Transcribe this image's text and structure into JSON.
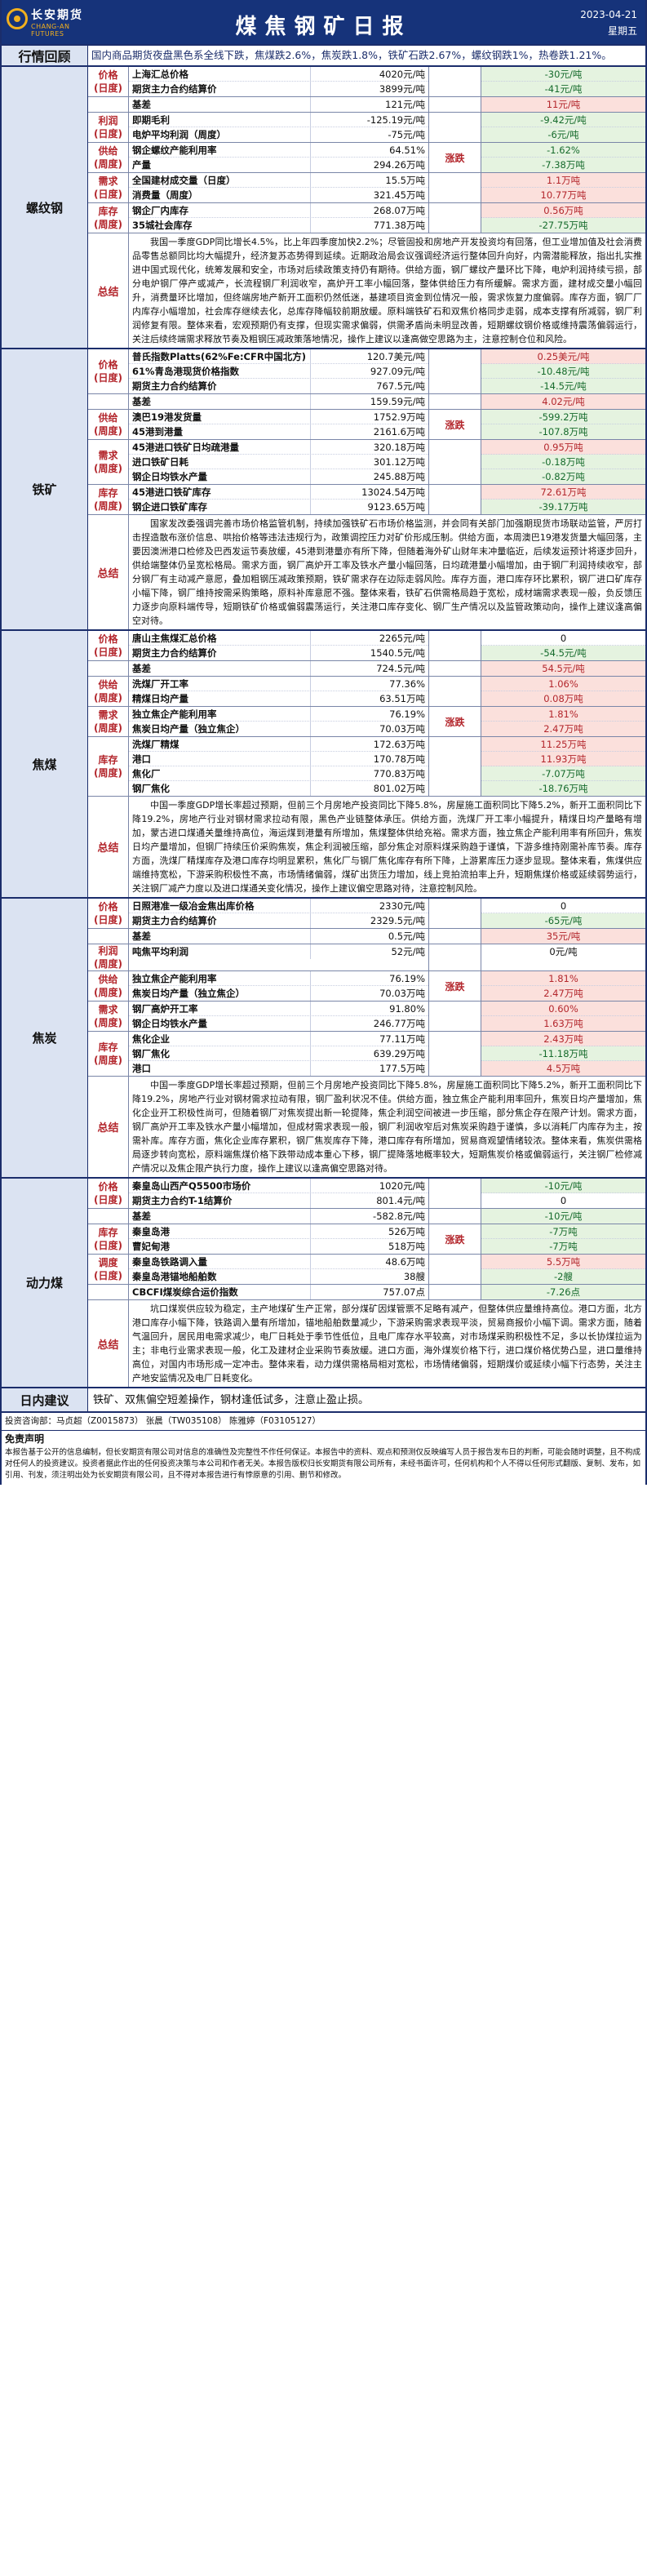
{
  "header": {
    "logo_cn": "长安期货",
    "logo_en": "CHANG-AN FUTURES",
    "title": "煤焦钢矿日报",
    "date": "2023-04-21",
    "weekday": "星期五"
  },
  "review": {
    "label": "行情回顾",
    "text": "国内商品期货夜盘黑色系全线下跌，焦煤跌2.6%，焦炭跌1.8%，铁矿石跌2.67%，螺纹钢跌1%，热卷跌1.21%。"
  },
  "colors": {
    "header_bg": "#16337a",
    "label_bg": "#dbe3f2",
    "negative": "#166b2c",
    "positive": "#b3262c"
  },
  "sections": [
    {
      "name": "螺纹钢",
      "groups": [
        {
          "label": [
            "价格",
            "(日度)"
          ],
          "trend": "",
          "rows": [
            {
              "name": "上海汇总价格",
              "value": "4020元/吨",
              "change": "-30元/吨",
              "sign": "neg"
            },
            {
              "name": "期货主力合约结算价",
              "value": "3899元/吨",
              "change": "-41元/吨",
              "sign": "neg"
            }
          ]
        },
        {
          "label": [
            ""
          ],
          "trend": "",
          "rows": [
            {
              "name": "基差",
              "value": "121元/吨",
              "change": "11元/吨",
              "sign": "pos"
            }
          ]
        },
        {
          "label": [
            "利润",
            "(日度)"
          ],
          "trend": "",
          "rows": [
            {
              "name": "即期毛利",
              "value": "-125.19元/吨",
              "change": "-9.42元/吨",
              "sign": "neg"
            },
            {
              "name": "电炉平均利润（周度）",
              "value": "-75元/吨",
              "change": "-6元/吨",
              "sign": "neg"
            }
          ]
        },
        {
          "label": [
            "供给",
            "(周度)"
          ],
          "trend": "涨跌",
          "rows": [
            {
              "name": "钢企螺纹产能利用率",
              "value": "64.51%",
              "change": "-1.62%",
              "sign": "neg"
            },
            {
              "name": "产量",
              "value": "294.26万吨",
              "change": "-7.38万吨",
              "sign": "neg"
            }
          ]
        },
        {
          "label": [
            "需求",
            "(日度)"
          ],
          "trend": "",
          "rows": [
            {
              "name": "全国建材成交量（日度）",
              "value": "15.5万吨",
              "change": "1.1万吨",
              "sign": "pos"
            },
            {
              "name": "消费量（周度）",
              "value": "321.45万吨",
              "change": "10.77万吨",
              "sign": "pos"
            }
          ]
        },
        {
          "label": [
            "库存",
            "(周度)"
          ],
          "trend": "",
          "rows": [
            {
              "name": "钢企厂内库存",
              "value": "268.07万吨",
              "change": "0.56万吨",
              "sign": "pos"
            },
            {
              "name": "35城社会库存",
              "value": "771.38万吨",
              "change": "-27.75万吨",
              "sign": "neg"
            }
          ]
        }
      ],
      "summary": "我国一季度GDP同比增长4.5%，比上年四季度加快2.2%；尽管固投和房地产开发投资均有回落，但工业增加值及社会消费品零售总额同比均大幅提升，经济复苏态势得到延续。近期政治局会议强调经济运行整体回升向好，内需潜能释放，指出扎实推进中国式现代化，统筹发展和安全，市场对后续政策支持仍有期待。供给方面，钢厂螺纹产量环比下降，电炉利润持续亏损，部分电炉钢厂停产或减产，长流程钢厂利润收窄，高炉开工率小幅回落，整体供给压力有所缓解。需求方面，建材成交量小幅回升，消费量环比增加，但终端房地产新开工面积仍然低迷，基建项目资金到位情况一般，需求恢复力度偏弱。库存方面，钢厂厂内库存小幅增加，社会库存继续去化，总库存降幅较前期放缓。原料端铁矿石和双焦价格同步走弱，成本支撑有所减弱，钢厂利润修复有限。整体来看，宏观预期仍有支撑，但现实需求偏弱，供需矛盾尚未明显改善，短期螺纹钢价格或维持震荡偏弱运行，关注后续终端需求释放节奏及粗钢压减政策落地情况，操作上建议以逢高做空思路为主，注意控制仓位和风险。"
    },
    {
      "name": "铁矿",
      "groups": [
        {
          "label": [
            "价格",
            "(日度)"
          ],
          "trend": "",
          "rows": [
            {
              "name": "普氏指数Platts(62%Fe:CFR中国北方)",
              "value": "120.7美元/吨",
              "change": "0.25美元/吨",
              "sign": "pos"
            },
            {
              "name": "61%青岛港现货价格指数",
              "value": "927.09元/吨",
              "change": "-10.48元/吨",
              "sign": "neg"
            },
            {
              "name": "期货主力合约结算价",
              "value": "767.5元/吨",
              "change": "-14.5元/吨",
              "sign": "neg"
            }
          ]
        },
        {
          "label": [
            ""
          ],
          "trend": "",
          "rows": [
            {
              "name": "基差",
              "value": "159.59元/吨",
              "change": "4.02元/吨",
              "sign": "pos"
            }
          ]
        },
        {
          "label": [
            "供给",
            "(周度)"
          ],
          "trend": "涨跌",
          "rows": [
            {
              "name": "澳巴19港发货量",
              "value": "1752.9万吨",
              "change": "-599.2万吨",
              "sign": "neg"
            },
            {
              "name": "45港到港量",
              "value": "2161.6万吨",
              "change": "-107.8万吨",
              "sign": "neg"
            }
          ]
        },
        {
          "label": [
            "需求",
            "(周度)"
          ],
          "trend": "",
          "rows": [
            {
              "name": "45港进口铁矿日均疏港量",
              "value": "320.18万吨",
              "change": "0.95万吨",
              "sign": "pos"
            },
            {
              "name": "进口铁矿日耗",
              "value": "301.12万吨",
              "change": "-0.18万吨",
              "sign": "neg"
            },
            {
              "name": "钢企日均铁水产量",
              "value": "245.88万吨",
              "change": "-0.82万吨",
              "sign": "neg"
            }
          ]
        },
        {
          "label": [
            "库存",
            "(周度)"
          ],
          "trend": "",
          "rows": [
            {
              "name": "45港进口铁矿库存",
              "value": "13024.54万吨",
              "change": "72.61万吨",
              "sign": "pos"
            },
            {
              "name": "钢企进口铁矿库存",
              "value": "9123.65万吨",
              "change": "-39.17万吨",
              "sign": "neg"
            }
          ]
        }
      ],
      "summary": "国家发改委强调完善市场价格监管机制，持续加强铁矿石市场价格监测，并会同有关部门加强期现货市场联动监管，严厉打击捏造散布涨价信息、哄抬价格等违法违规行为，政策调控压力对矿价形成压制。供给方面，本周澳巴19港发货量大幅回落，主要因澳洲港口检修及巴西发运节奏放缓，45港到港量亦有所下降，但随着海外矿山财年末冲量临近，后续发运预计将逐步回升，供给端整体仍呈宽松格局。需求方面，钢厂高炉开工率及铁水产量小幅回落，日均疏港量小幅增加，由于钢厂利润持续收窄，部分钢厂有主动减产意愿，叠加粗钢压减政策预期，铁矿需求存在边际走弱风险。库存方面，港口库存环比累积，钢厂进口矿库存小幅下降，钢厂维持按需采购策略，原料补库意愿不强。整体来看，铁矿石供需格局趋于宽松，成材端需求表现一般，负反馈压力逐步向原料端传导，短期铁矿价格或偏弱震荡运行，关注港口库存变化、钢厂生产情况以及监管政策动向，操作上建议逢高偏空对待。"
    },
    {
      "name": "焦煤",
      "groups": [
        {
          "label": [
            "价格",
            "(日度)"
          ],
          "trend": "",
          "rows": [
            {
              "name": "唐山主焦煤汇总价格",
              "value": "2265元/吨",
              "change": "0",
              "sign": "zero"
            },
            {
              "name": "期货主力合约结算价",
              "value": "1540.5元/吨",
              "change": "-54.5元/吨",
              "sign": "neg"
            }
          ]
        },
        {
          "label": [
            ""
          ],
          "trend": "",
          "rows": [
            {
              "name": "基差",
              "value": "724.5元/吨",
              "change": "54.5元/吨",
              "sign": "pos"
            }
          ]
        },
        {
          "label": [
            "供给",
            "(周度)"
          ],
          "trend": "",
          "rows": [
            {
              "name": "洗煤厂开工率",
              "value": "77.36%",
              "change": "1.06%",
              "sign": "pos"
            },
            {
              "name": "精煤日均产量",
              "value": "63.51万吨",
              "change": "0.08万吨",
              "sign": "pos"
            }
          ]
        },
        {
          "label": [
            "需求",
            "(周度)"
          ],
          "trend": "涨跌",
          "rows": [
            {
              "name": "独立焦企产能利用率",
              "value": "76.19%",
              "change": "1.81%",
              "sign": "pos"
            },
            {
              "name": "焦炭日均产量（独立焦企）",
              "value": "70.03万吨",
              "change": "2.47万吨",
              "sign": "pos"
            }
          ]
        },
        {
          "label": [
            "库存",
            "(周度)"
          ],
          "trend": "",
          "rows": [
            {
              "name": "洗煤厂精煤",
              "value": "172.63万吨",
              "change": "11.25万吨",
              "sign": "pos"
            },
            {
              "name": "港口",
              "value": "170.78万吨",
              "change": "11.93万吨",
              "sign": "pos"
            },
            {
              "name": "焦化厂",
              "value": "770.83万吨",
              "change": "-7.07万吨",
              "sign": "neg"
            },
            {
              "name": "钢厂焦化",
              "value": "801.02万吨",
              "change": "-18.76万吨",
              "sign": "neg"
            }
          ]
        }
      ],
      "summary": "中国一季度GDP增长率超过预期，但前三个月房地产投资同比下降5.8%，房屋施工面积同比下降5.2%，新开工面积同比下降19.2%，房地产行业对钢材需求拉动有限，黑色产业链整体承压。供给方面，洗煤厂开工率小幅提升，精煤日均产量略有增加，蒙古进口煤通关量维持高位，海运煤到港量有所增加，焦煤整体供给充裕。需求方面，独立焦企产能利用率有所回升，焦炭日均产量增加，但钢厂持续压价采购焦炭，焦企利润被压缩，部分焦企对原料煤采购趋于谨慎，下游多维持刚需补库节奏。库存方面，洗煤厂精煤库存及港口库存均明显累积，焦化厂与钢厂焦化库存有所下降，上游累库压力逐步显现。整体来看，焦煤供应端维持宽松，下游采购积极性不高，市场情绪偏弱，煤矿出货压力增加，线上竞拍流拍率上升，短期焦煤价格或延续弱势运行，关注钢厂减产力度以及进口煤通关变化情况，操作上建议偏空思路对待，注意控制风险。"
    },
    {
      "name": "焦炭",
      "groups": [
        {
          "label": [
            "价格",
            "(日度)"
          ],
          "trend": "",
          "rows": [
            {
              "name": "日照港准一级冶金焦出库价格",
              "value": "2330元/吨",
              "change": "0",
              "sign": "zero"
            },
            {
              "name": "期货主力合约结算价",
              "value": "2329.5元/吨",
              "change": "-65元/吨",
              "sign": "neg"
            }
          ]
        },
        {
          "label": [
            ""
          ],
          "trend": "",
          "rows": [
            {
              "name": "基差",
              "value": "0.5元/吨",
              "change": "35元/吨",
              "sign": "pos"
            }
          ]
        },
        {
          "label": [
            "利润",
            "(周度)"
          ],
          "trend": "",
          "rows": [
            {
              "name": "吨焦平均利润",
              "value": "52元/吨",
              "change": "0元/吨",
              "sign": "zero"
            }
          ]
        },
        {
          "label": [
            "供给",
            "(周度)"
          ],
          "trend": "涨跌",
          "rows": [
            {
              "name": "独立焦企产能利用率",
              "value": "76.19%",
              "change": "1.81%",
              "sign": "pos"
            },
            {
              "name": "焦炭日均产量（独立焦企）",
              "value": "70.03万吨",
              "change": "2.47万吨",
              "sign": "pos"
            }
          ]
        },
        {
          "label": [
            "需求",
            "(周度)"
          ],
          "trend": "",
          "rows": [
            {
              "name": "钢厂高炉开工率",
              "value": "91.80%",
              "change": "0.60%",
              "sign": "pos"
            },
            {
              "name": "钢企日均铁水产量",
              "value": "246.77万吨",
              "change": "1.63万吨",
              "sign": "pos"
            }
          ]
        },
        {
          "label": [
            "库存",
            "(周度)"
          ],
          "trend": "",
          "rows": [
            {
              "name": "焦化企业",
              "value": "77.11万吨",
              "change": "2.43万吨",
              "sign": "pos"
            },
            {
              "name": "钢厂焦化",
              "value": "639.29万吨",
              "change": "-11.18万吨",
              "sign": "neg"
            },
            {
              "name": "港口",
              "value": "177.5万吨",
              "change": "4.5万吨",
              "sign": "pos"
            }
          ]
        }
      ],
      "summary": "中国一季度GDP增长率超过预期，但前三个月房地产投资同比下降5.8%，房屋施工面积同比下降5.2%，新开工面积同比下降19.2%，房地产行业对钢材需求拉动有限，钢厂盈利状况不佳。供给方面，独立焦企产能利用率回升，焦炭日均产量增加，焦化企业开工积极性尚可，但随着钢厂对焦炭提出新一轮提降，焦企利润空间被进一步压缩，部分焦企存在限产计划。需求方面，钢厂高炉开工率及铁水产量小幅增加，但成材需求表现一般，钢厂利润收窄后对焦炭采购趋于谨慎，多以消耗厂内库存为主，按需补库。库存方面，焦化企业库存累积，钢厂焦炭库存下降，港口库存有所增加，贸易商观望情绪较浓。整体来看，焦炭供需格局逐步转向宽松，原料端焦煤价格下跌带动成本重心下移，钢厂提降落地概率较大，短期焦炭价格或偏弱运行，关注钢厂检修减产情况以及焦企限产执行力度，操作上建议以逢高偏空思路对待。"
    },
    {
      "name": "动力煤",
      "groups": [
        {
          "label": [
            "价格",
            "(日度)"
          ],
          "trend": "",
          "rows": [
            {
              "name": "秦皇岛山西产Q5500市场价",
              "value": "1020元/吨",
              "change": "-10元/吨",
              "sign": "neg"
            },
            {
              "name": "期货主力合约T-1结算价",
              "value": "801.4元/吨",
              "change": "0",
              "sign": "zero"
            }
          ]
        },
        {
          "label": [
            ""
          ],
          "trend": "",
          "rows": [
            {
              "name": "基差",
              "value": "-582.8元/吨",
              "change": "-10元/吨",
              "sign": "neg"
            }
          ]
        },
        {
          "label": [
            "库存",
            "(日度)"
          ],
          "trend": "涨跌",
          "rows": [
            {
              "name": "秦皇岛港",
              "value": "526万吨",
              "change": "-7万吨",
              "sign": "neg"
            },
            {
              "name": "曹妃甸港",
              "value": "518万吨",
              "change": "-7万吨",
              "sign": "neg"
            }
          ]
        },
        {
          "label": [
            "调度",
            "(日度)"
          ],
          "trend": "",
          "rows": [
            {
              "name": "秦皇岛铁路调入量",
              "value": "48.6万吨",
              "change": "5.5万吨",
              "sign": "pos"
            },
            {
              "name": "秦皇岛港锚地船舶数",
              "value": "38艘",
              "change": "-2艘",
              "sign": "neg"
            }
          ]
        },
        {
          "label": [
            ""
          ],
          "trend": "",
          "rows": [
            {
              "name": "CBCFI煤炭综合运价指数",
              "value": "757.07点",
              "change": "-7.26点",
              "sign": "neg"
            }
          ]
        }
      ],
      "summary": "坑口煤炭供应较为稳定，主产地煤矿生产正常，部分煤矿因煤管票不足略有减产，但整体供应量维持高位。港口方面，北方港口库存小幅下降，铁路调入量有所增加，锚地船舶数量减少，下游采购需求表现平淡，贸易商报价小幅下调。需求方面，随着气温回升，居民用电需求减少，电厂日耗处于季节性低位，且电厂库存水平较高，对市场煤采购积极性不足，多以长协煤拉运为主；非电行业需求表现一般，化工及建材企业采购节奏放缓。进口方面，海外煤炭价格下行，进口煤价格优势凸显，进口量维持高位，对国内市场形成一定冲击。整体来看，动力煤供需格局相对宽松，市场情绪偏弱，短期煤价或延续小幅下行态势，关注主产地安监情况及电厂日耗变化。"
    }
  ],
  "advice": {
    "label": "日内建议",
    "text": "铁矿、双焦偏空短差操作，钢材逢低试多，注意止盈止损。"
  },
  "team": "投资咨询部：马贞超（Z0015873） 张晨（TW035108） 陈雅婷（F03105127）",
  "disclaimer": {
    "title": "免责声明",
    "text": "本报告基于公开的信息编制，但长安期货有限公司对信息的准确性及完整性不作任何保证。本报告中的资料、观点和预测仅反映编写人员于报告发布日的判断，可能会随时调整，且不构成对任何人的投资建议。投资者据此作出的任何投资决策与本公司和作者无关。本报告版权归长安期货有限公司所有，未经书面许可，任何机构和个人不得以任何形式翻版、复制、发布，如引用、刊发，须注明出处为长安期货有限公司，且不得对本报告进行有悖原意的引用、删节和修改。"
  }
}
